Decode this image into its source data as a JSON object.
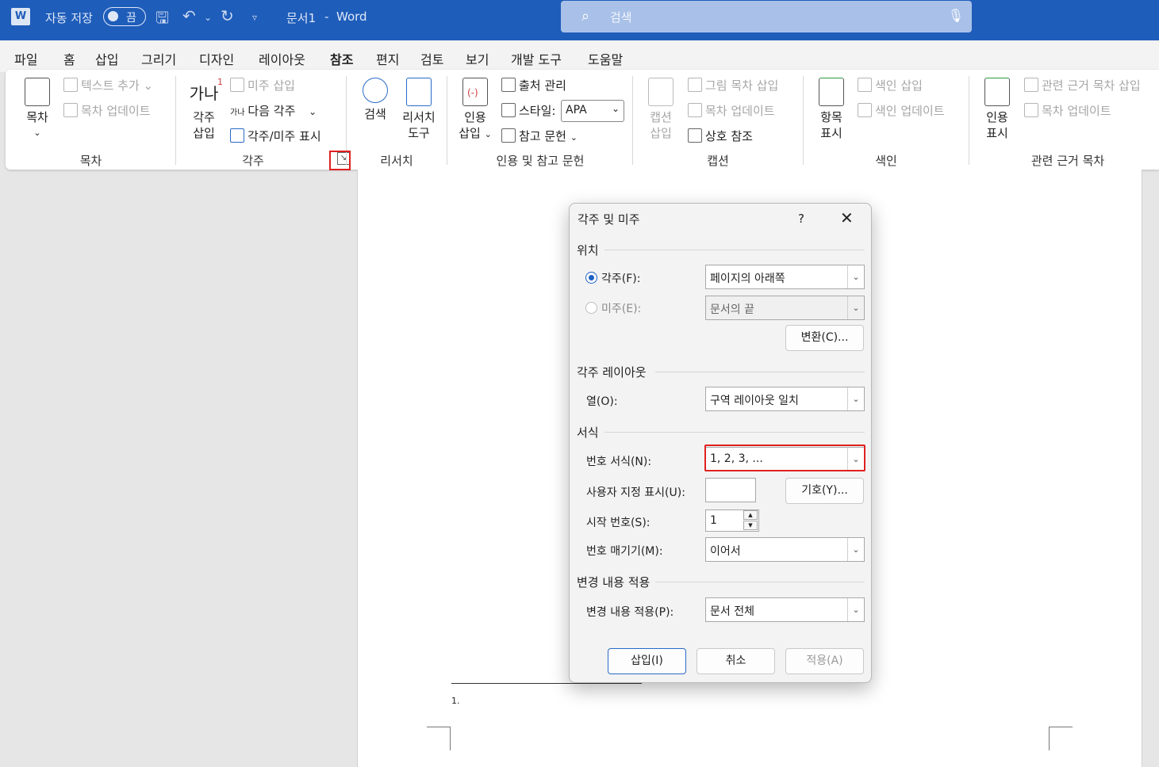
{
  "titlebar": {
    "app_icon": "word-icon",
    "autosave_label": "자동 저장",
    "autosave_state": "끔",
    "doc_title": "문서1",
    "app_name": "Word",
    "search_placeholder": "검색"
  },
  "menu": {
    "tabs": [
      "파일",
      "홈",
      "삽입",
      "그리기",
      "디자인",
      "레이아웃",
      "참조",
      "편지",
      "검토",
      "보기",
      "개발 도구",
      "도움말"
    ],
    "active_tab": "참조"
  },
  "ribbon": {
    "toc": {
      "button_line1": "목차",
      "add_text": "텍스트 추가",
      "update": "목차 업데이트",
      "group": "목차"
    },
    "footnotes": {
      "hangul_icon_text": "가나",
      "button_line1": "각주",
      "button_line2": "삽입",
      "insert_endnote": "미주 삽입",
      "next_small": "가나",
      "next_footnote": "다음 각주",
      "show_notes": "각주/미주 표시",
      "group": "각주"
    },
    "research": {
      "search": "검색",
      "researcher_line1": "리서치",
      "researcher_line2": "도구",
      "group": "리서치"
    },
    "citations": {
      "insert_line1": "인용",
      "insert_line2": "삽입",
      "manage_sources": "출처 관리",
      "style_label": "스타일:",
      "style_value": "APA",
      "bibliography": "참고 문헌",
      "group": "인용 및 참고 문헌"
    },
    "captions": {
      "insert_line1": "캡션",
      "insert_line2": "삽입",
      "insert_tof": "그림 목차 삽입",
      "update_table": "목차 업데이트",
      "cross_ref": "상호 참조",
      "group": "캡션"
    },
    "index": {
      "mark_line1": "항목",
      "mark_line2": "표시",
      "insert_index": "색인 삽입",
      "update_index": "색인 업데이트",
      "group": "색인"
    },
    "authorities": {
      "mark_line1": "인용",
      "mark_line2": "표시",
      "insert_toa": "관련 근거 목차 삽입",
      "update_table": "목차 업데이트",
      "group": "관련 근거 목차"
    }
  },
  "dialog": {
    "title": "각주 및 미주",
    "help": "?",
    "location_section": "위치",
    "footnote_label": "각주(F):",
    "footnote_value": "페이지의 아래쪽",
    "endnote_label": "미주(E):",
    "endnote_value": "문서의 끝",
    "convert_button": "변환(C)...",
    "layout_section": "각주 레이아웃",
    "columns_label": "열(O):",
    "columns_value": "구역 레이아웃 일치",
    "format_section": "서식",
    "number_format_label": "번호 서식(N):",
    "number_format_value": "1, 2, 3, ...",
    "custom_mark_label": "사용자 지정 표시(U):",
    "custom_mark_value": "",
    "symbol_button": "기호(Y)...",
    "start_at_label": "시작 번호(S):",
    "start_at_value": "1",
    "numbering_label": "번호 매기기(M):",
    "numbering_value": "이어서",
    "apply_section": "변경 내용 적용",
    "apply_to_label": "변경 내용 적용(P):",
    "apply_to_value": "문서 전체",
    "insert_button": "삽입(I)",
    "cancel_button": "취소",
    "apply_button": "적용(A)"
  },
  "document": {
    "footnote_number": "1."
  },
  "colors": {
    "titlebar": "#1f5dba",
    "highlight": "#e02020",
    "radio_accent": "#1e62c3"
  }
}
